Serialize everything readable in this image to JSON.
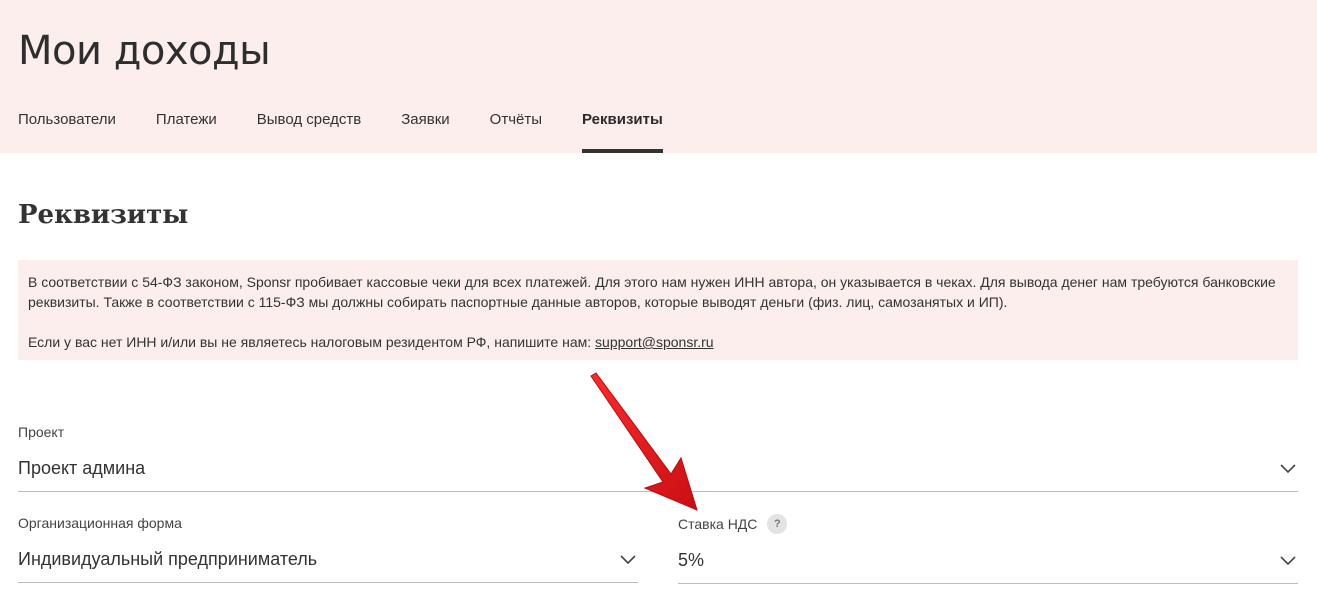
{
  "header": {
    "title": "Мои доходы",
    "tabs": [
      {
        "label": "Пользователи",
        "active": false
      },
      {
        "label": "Платежи",
        "active": false
      },
      {
        "label": "Вывод средств",
        "active": false
      },
      {
        "label": "Заявки",
        "active": false
      },
      {
        "label": "Отчёты",
        "active": false
      },
      {
        "label": "Реквизиты",
        "active": true
      }
    ]
  },
  "main": {
    "section_title": "Реквизиты",
    "notice": {
      "paragraph1": "В соответствии с 54-ФЗ законом, Sponsr пробивает кассовые чеки для всех платежей. Для этого нам нужен ИНН автора, он указывается в чеках. Для вывода денег нам требуются банковские реквизиты. Также в соответствии с 115-ФЗ мы должны собирать паспортные данные авторов, которые выводят деньги (физ. лиц, самозанятых и ИП).",
      "paragraph2_prefix": "Если у вас нет ИНН и/или вы не являетесь налоговым резидентом РФ, напишите нам: ",
      "support_email": "support@sponsr.ru"
    },
    "fields": {
      "project": {
        "label": "Проект",
        "value": "Проект админа"
      },
      "org_form": {
        "label": "Организационная форма",
        "value": "Индивидуальный предприниматель"
      },
      "vat_rate": {
        "label": "Ставка НДС",
        "value": "5%",
        "help": "?"
      }
    }
  },
  "colors": {
    "header_bg": "#fbeeec",
    "notice_bg": "#fbeeec",
    "annotation_arrow": "#e3141b"
  },
  "icons": {
    "dropdown": "chevron-down-icon",
    "help": "question-icon",
    "annotation": "red-arrow-icon"
  }
}
